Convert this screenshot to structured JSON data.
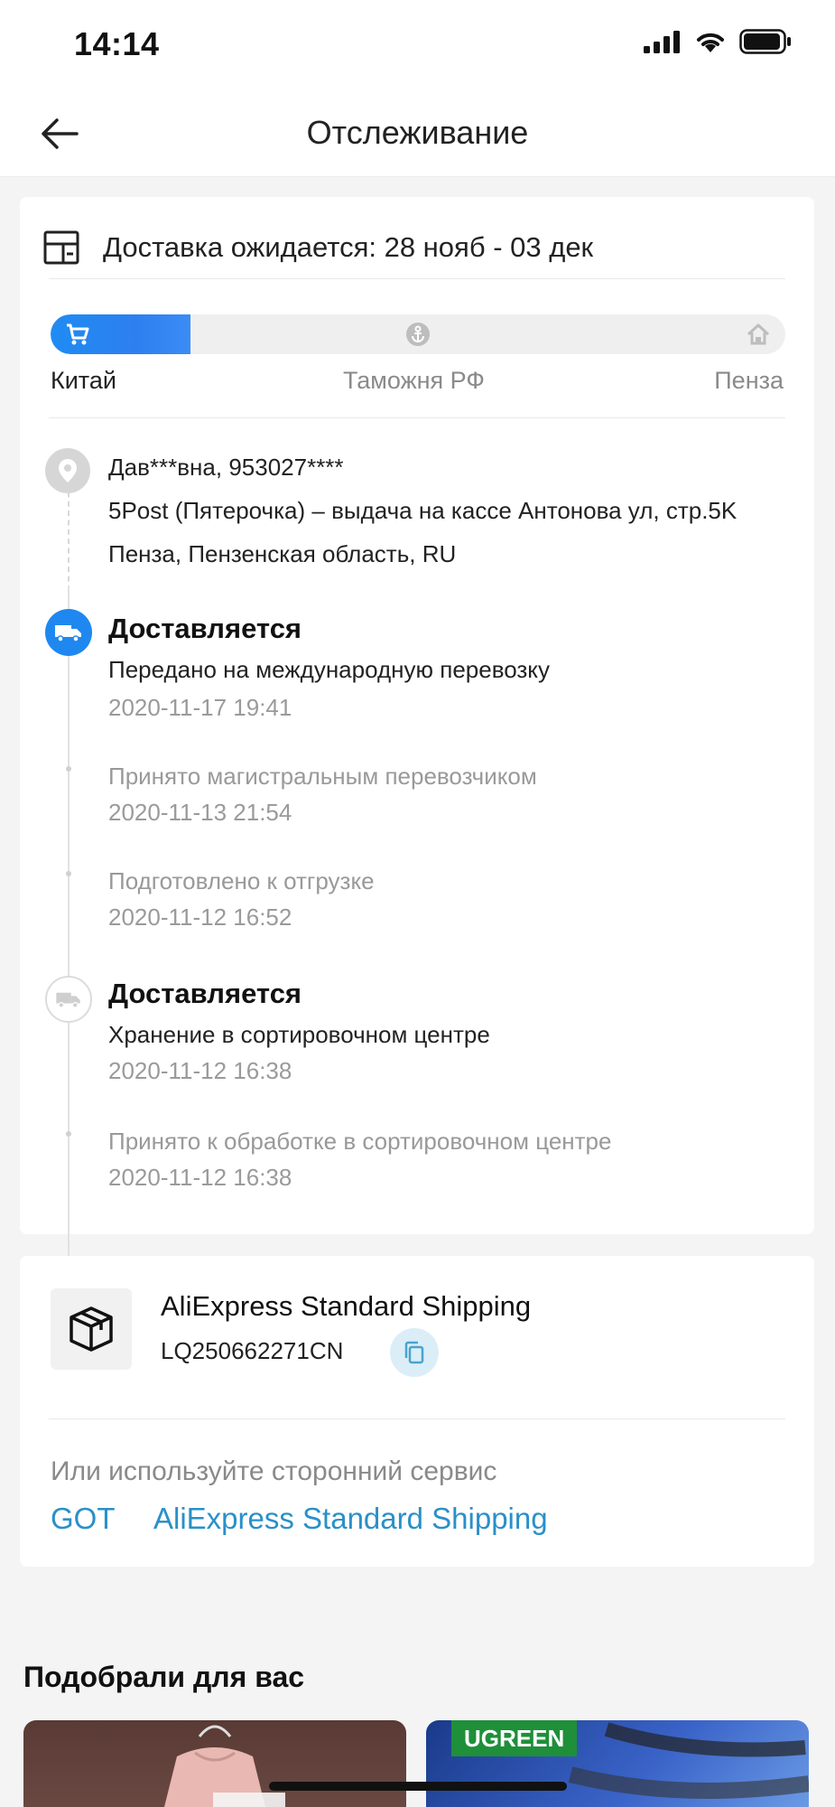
{
  "status_bar": {
    "time": "14:14"
  },
  "nav": {
    "title": "Отслеживание"
  },
  "delivery": {
    "expected": "Доставка ожидается: 28 нояб - 03 дек"
  },
  "progress": {
    "fraction": 0.19,
    "stages": [
      "Китай",
      "Таможня РФ",
      "Пенза"
    ]
  },
  "address": {
    "recipient": "Дав***вна, 953027****",
    "line1": "5Post (Пятерочка) – выдача на кассе Антонова ул, стр.5K",
    "line2": "Пенза, Пензенская область, RU"
  },
  "events": [
    {
      "title": "Доставляется",
      "desc": "Передано на международную перевозку",
      "date": "2020-11-17 19:41"
    },
    {
      "desc": "Принято магистральным перевозчиком",
      "date": "2020-11-13 21:54"
    },
    {
      "desc": "Подготовлено к отгрузке",
      "date": "2020-11-12 16:52"
    },
    {
      "title": "Доставляется",
      "desc": "Хранение в сортировочном центре",
      "date": "2020-11-12 16:38"
    },
    {
      "desc": "Принято к обработке в сортировочном центре",
      "date": "2020-11-12 16:38"
    }
  ],
  "shipping": {
    "carrier": "AliExpress Standard Shipping",
    "tracking_number": "LQ250662271CN",
    "third_party_label": "Или используйте сторонний сервис",
    "links": [
      "GOT",
      "AliExpress Standard Shipping"
    ]
  },
  "recommendations": {
    "title": "Подобрали для вас",
    "products": [
      {
        "brand": ""
      },
      {
        "brand": "UGREEN"
      }
    ]
  },
  "colors": {
    "accent_blue": "#1f88f0",
    "link": "#2a90c8"
  }
}
